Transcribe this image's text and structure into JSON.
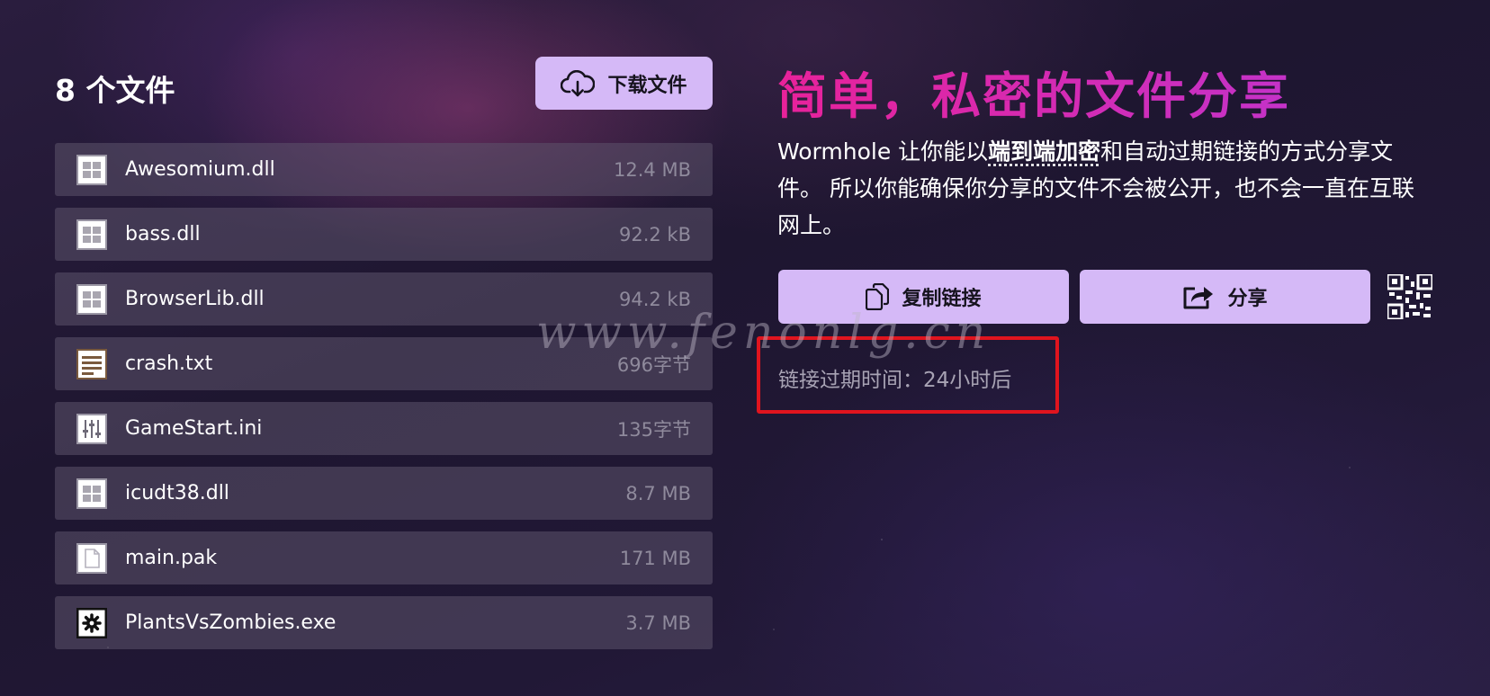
{
  "files_panel": {
    "title": "8 个文件",
    "download_label": "下载文件",
    "files": [
      {
        "name": "Awesomium.dll",
        "size": "12.4 MB",
        "icon": "windows-file-icon"
      },
      {
        "name": "bass.dll",
        "size": "92.2 kB",
        "icon": "windows-file-icon"
      },
      {
        "name": "BrowserLib.dll",
        "size": "94.2 kB",
        "icon": "windows-file-icon"
      },
      {
        "name": "crash.txt",
        "size": "696字节",
        "icon": "text-file-icon"
      },
      {
        "name": "GameStart.ini",
        "size": "135字节",
        "icon": "settings-file-icon"
      },
      {
        "name": "icudt38.dll",
        "size": "8.7 MB",
        "icon": "windows-file-icon"
      },
      {
        "name": "main.pak",
        "size": "171 MB",
        "icon": "blank-file-icon"
      },
      {
        "name": "PlantsVsZombies.exe",
        "size": "3.7 MB",
        "icon": "gear-file-icon"
      }
    ]
  },
  "info_panel": {
    "headline": "简单，私密的文件分享",
    "desc_prefix": "Wormhole 让你能以",
    "desc_emphasis": "端到端加密",
    "desc_suffix": "和自动过期链接的方式分享文件。 所以你能确保你分享的文件不会被公开，也不会一直在互联网上。",
    "copy_label": "复制链接",
    "share_label": "分享",
    "expiry_text": "链接过期时间：24小时后"
  },
  "watermark": "www.fenonlg.cn",
  "colors": {
    "accent": "#d5b9f7",
    "headline": "#e02fa8",
    "highlight_border": "#e0141e"
  }
}
